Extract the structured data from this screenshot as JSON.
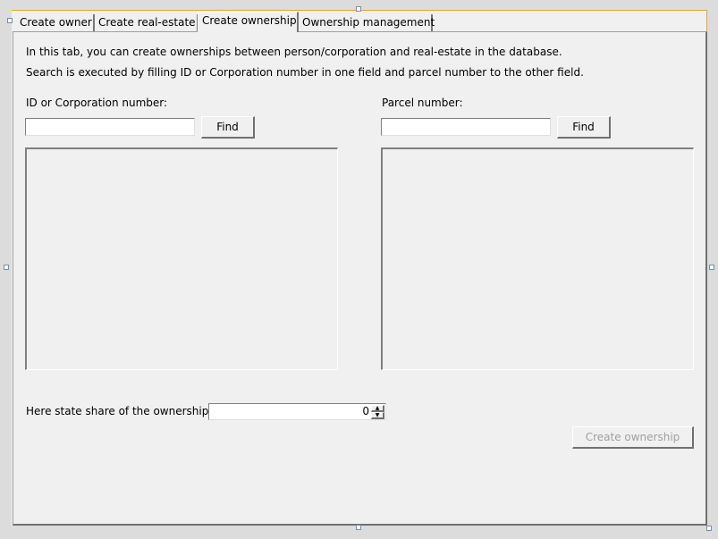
{
  "tabs": [
    {
      "label": "Create owner"
    },
    {
      "label": "Create real-estate"
    },
    {
      "label": "Create ownership"
    },
    {
      "label": "Ownership management"
    }
  ],
  "intro": {
    "line1": "In this tab, you can create ownerships between person/corporation and real-estate in the database.",
    "line2": "Search is executed by filling ID or Corporation number in one field and parcel number to the other field."
  },
  "left": {
    "label": "ID or Corporation number:",
    "value": "",
    "find": "Find"
  },
  "right": {
    "label": "Parcel number:",
    "value": "",
    "find": "Find"
  },
  "share": {
    "label": "Here state share of the ownership:",
    "value": "0"
  },
  "create_button": "Create ownership"
}
